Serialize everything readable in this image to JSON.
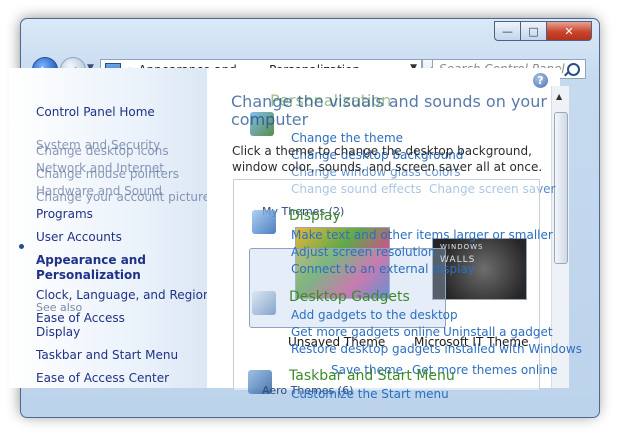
{
  "window": {
    "minimize": "—",
    "maximize": "□",
    "close": "✕"
  },
  "nav": {
    "back_glyph": "←",
    "forward_glyph": "→",
    "breadcrumb": [
      "Appearance and ...",
      "Personalization"
    ],
    "breadcrumb_prefix": "«",
    "breadcrumb_sep": "▸",
    "search_placeholder": "Search Control Panel"
  },
  "left": {
    "home": "Control Panel Home",
    "items": [
      "System and Security",
      "Network and Internet",
      "Hardware and Sound",
      "Programs",
      "User Accounts",
      "Appearance and Personalization",
      "Clock, Language, and Region",
      "Ease of Access"
    ],
    "overlay_items": [
      "Change desktop icons",
      "Change mouse pointers",
      "Change your account picture"
    ],
    "see_also": "See also",
    "see_also_links": [
      "Display",
      "Taskbar and Start Menu",
      "Ease of Access Center"
    ]
  },
  "main": {
    "help": "?",
    "title_line1": "Change the visuals and sounds on your",
    "title_line2": "computer",
    "overlay_title": "Personalization",
    "description": "Click a theme to change the desktop background, window color, sounds, and screen saver all at once.",
    "personalization_links": [
      "Change the theme",
      "Change desktop background",
      "Change window glass colors",
      "Change sound effects",
      "Change screen saver"
    ],
    "display_title": "Display",
    "display_links": [
      "Make text and other items larger or smaller",
      "Adjust screen resolution",
      "Connect to an external display"
    ],
    "gadgets_title": "Desktop Gadgets",
    "gadgets_links": [
      "Add gadgets to the desktop",
      "Get more gadgets online",
      "Uninstall a gadget",
      "Restore desktop gadgets installed with Windows"
    ],
    "taskbar_title": "Taskbar and Start Menu",
    "taskbar_links": [
      "Customize the Start menu"
    ],
    "my_themes": "My Themes (2)",
    "theme1": "Unsaved Theme",
    "theme2": "Microsoft IT Theme",
    "save_theme": "Save theme",
    "more_themes": "Get more themes online",
    "aero_themes": "Aero Themes (6)",
    "walls_line1": "WINDOWS",
    "walls_line2": "WALLS"
  }
}
